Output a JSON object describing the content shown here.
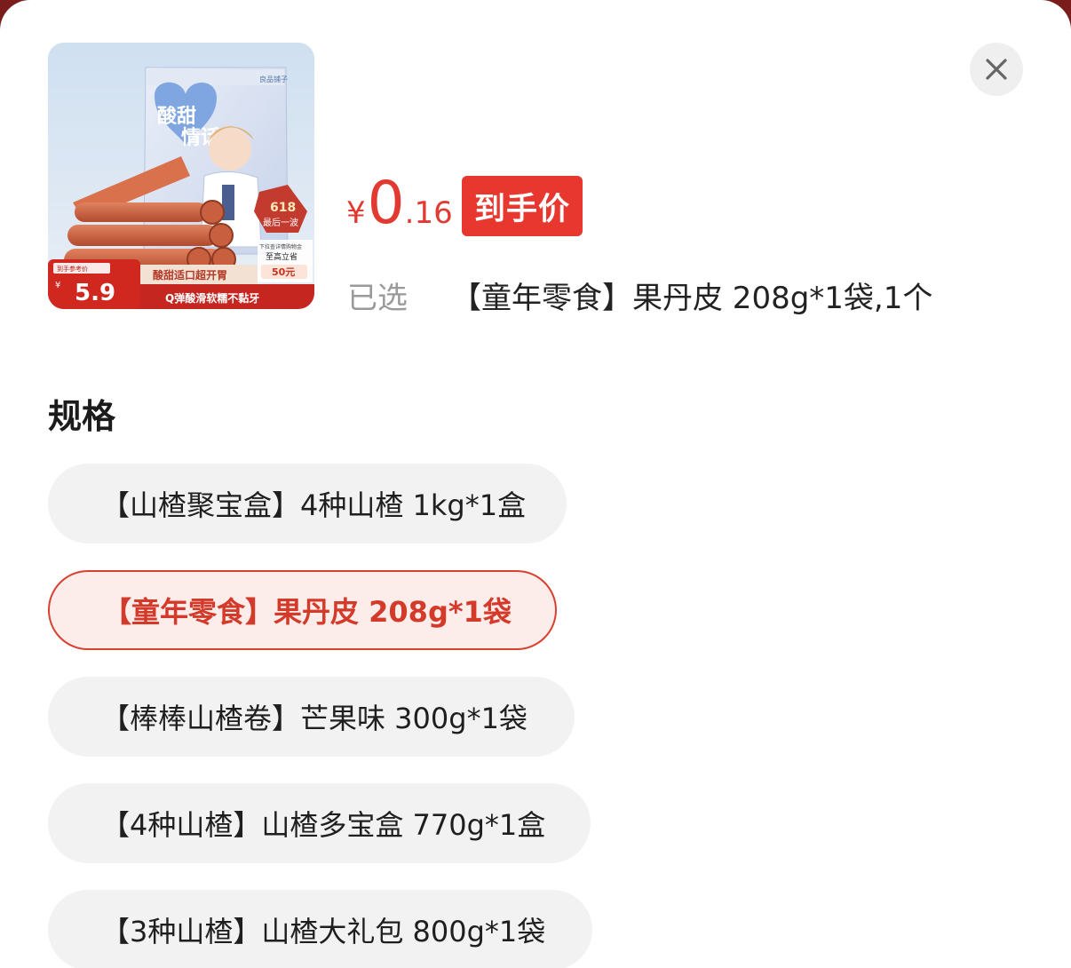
{
  "product": {
    "image_texts": {
      "brand": "良品铺子",
      "title_line1": "酸甜",
      "title_line2": "情话",
      "badge_top": "618",
      "badge_bottom": "最后一波",
      "promo_small": "下拉查详情购物金",
      "promo_mid": "至高立省",
      "promo_amount": "50元",
      "slogan": "酸甜适口超开胃",
      "footer": "Q弹酸滑软糯不黏牙",
      "ref_label": "到手参考价",
      "ref_currency": "¥",
      "ref_price": "5.9"
    }
  },
  "price": {
    "currency": "¥",
    "integer": "0",
    "decimal": ".16",
    "tag": "到手价"
  },
  "selection": {
    "label": "已选",
    "value": "【童年零食】果丹皮 208g*1袋,1个"
  },
  "spec": {
    "title": "规格",
    "options": [
      {
        "label": "【山楂聚宝盒】4种山楂 1kg*1盒"
      },
      {
        "label": "【童年零食】果丹皮 208g*1袋"
      },
      {
        "label": "【棒棒山楂卷】芒果味 300g*1袋"
      },
      {
        "label": "【4种山楂】山楂多宝盒 770g*1盒"
      },
      {
        "label": "【3种山楂】山楂大礼包 800g*1袋"
      }
    ],
    "selected_index": 1
  },
  "colors": {
    "accent": "#e8372f",
    "selected_border": "#d8412f",
    "selected_bg": "#fcecea",
    "option_bg": "#f2f2f2"
  },
  "icons": {
    "close": "close-icon"
  }
}
